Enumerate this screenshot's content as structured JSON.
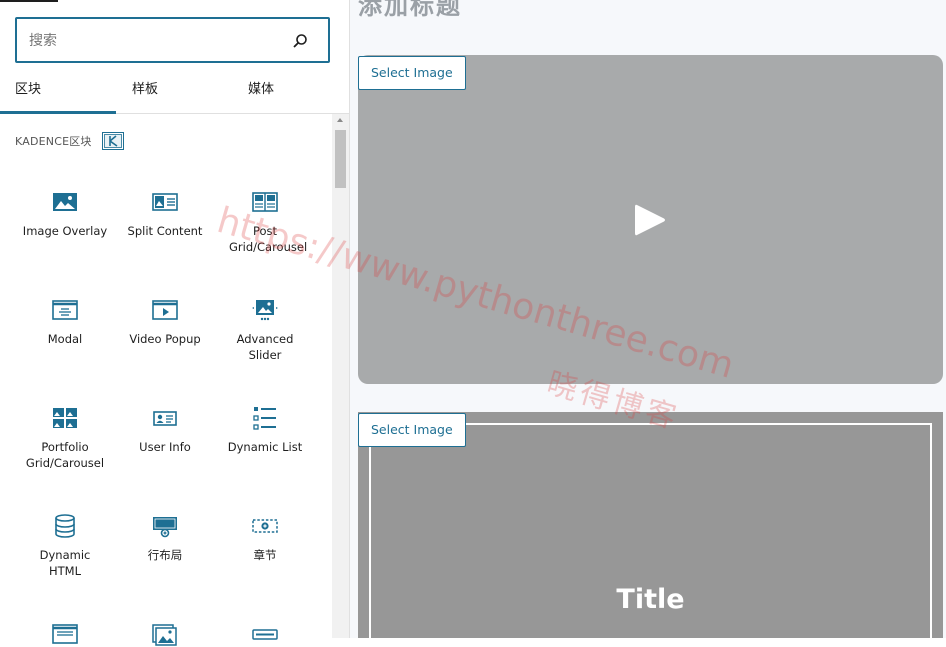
{
  "sidebar": {
    "search_placeholder": "搜索",
    "tabs": [
      {
        "label": "区块"
      },
      {
        "label": "样板"
      },
      {
        "label": "媒体"
      }
    ],
    "category_label": "KADENCE区块",
    "blocks": [
      {
        "label": "Image Overlay",
        "icon": "image-overlay-icon"
      },
      {
        "label": "Split Content",
        "icon": "split-content-icon"
      },
      {
        "label": "Post Grid/Carousel",
        "icon": "post-grid-icon"
      },
      {
        "label": "Modal",
        "icon": "modal-icon"
      },
      {
        "label": "Video Popup",
        "icon": "video-popup-icon"
      },
      {
        "label": "Advanced Slider",
        "icon": "advanced-slider-icon"
      },
      {
        "label": "Portfolio Grid/Carousel",
        "icon": "portfolio-grid-icon"
      },
      {
        "label": "User Info",
        "icon": "user-info-icon"
      },
      {
        "label": "Dynamic List",
        "icon": "dynamic-list-icon"
      },
      {
        "label": "Dynamic HTML",
        "icon": "dynamic-html-icon"
      },
      {
        "label": "行布局",
        "icon": "row-layout-icon"
      },
      {
        "label": "章节",
        "icon": "section-icon"
      }
    ]
  },
  "canvas": {
    "page_title": "添加标题",
    "select_image_1": "Select Image",
    "select_image_2": "Select Image",
    "overlay_title": "Title"
  },
  "watermark": {
    "url": "https://www.pythonthree.com",
    "name": "晓得博客"
  },
  "colors": {
    "accent": "#1e6f93",
    "icon": "#1e6f93",
    "video_bg": "#a8aaab",
    "overlay_bg": "#979797"
  }
}
